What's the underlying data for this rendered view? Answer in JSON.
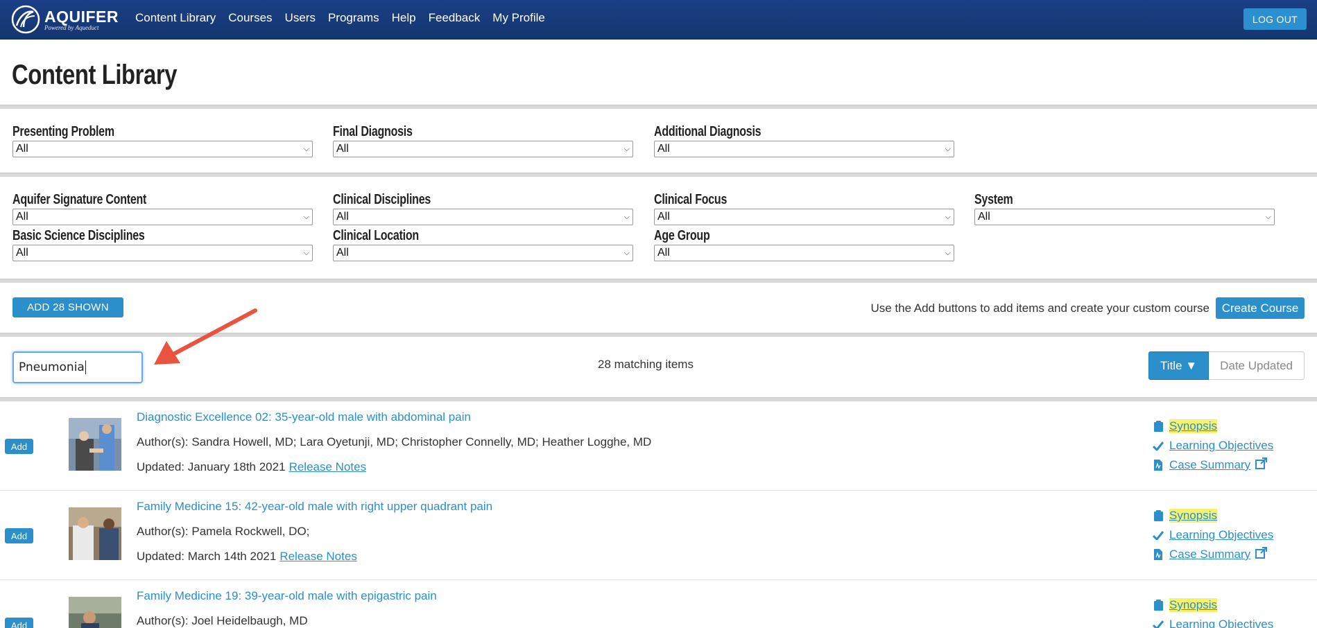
{
  "app": {
    "logo_text": "AQUIFER",
    "logo_sub": "Powered by Aqueduct"
  },
  "nav": {
    "links": [
      "Content Library",
      "Courses",
      "Users",
      "Programs",
      "Help",
      "Feedback",
      "My Profile"
    ],
    "logout": "LOG OUT"
  },
  "page": {
    "title": "Content Library"
  },
  "filters": {
    "presenting_problem": {
      "label": "Presenting Problem",
      "value": "All"
    },
    "final_diagnosis": {
      "label": "Final Diagnosis",
      "value": "All"
    },
    "additional_diagnosis": {
      "label": "Additional Diagnosis",
      "value": "All"
    },
    "signature_content": {
      "label": "Aquifer Signature Content",
      "value": "All"
    },
    "clinical_disciplines": {
      "label": "Clinical Disciplines",
      "value": "All"
    },
    "clinical_focus": {
      "label": "Clinical Focus",
      "value": "All"
    },
    "system": {
      "label": "System",
      "value": "All"
    },
    "basic_science": {
      "label": "Basic Science Disciplines",
      "value": "All"
    },
    "clinical_location": {
      "label": "Clinical Location",
      "value": "All"
    },
    "age_group": {
      "label": "Age Group",
      "value": "All"
    }
  },
  "actions": {
    "add_shown": "ADD 28 SHOWN",
    "hint": "Use the Add buttons to add items and create your custom course",
    "create_course": "Create Course"
  },
  "search": {
    "value": "Pneumonia"
  },
  "results": {
    "count_text": "28 matching items",
    "sort_title": "Title ▼",
    "sort_date": "Date Updated",
    "items": [
      {
        "add": "Add",
        "title": "Diagnostic Excellence 02: 35-year-old male with abdominal pain",
        "authors": "Author(s): Sandra Howell, MD; Lara Oyetunji, MD; Christopher Connelly, MD; Heather Logghe, MD",
        "updated": "Updated: January 18th 2021",
        "release_notes": "Release Notes",
        "synopsis": "Synopsis",
        "objectives": "Learning Objectives",
        "case_summary": "Case Summary"
      },
      {
        "add": "Add",
        "title": "Family Medicine 15: 42-year-old male with right upper quadrant pain",
        "authors": "Author(s): Pamela Rockwell, DO;",
        "updated": "Updated: March 14th 2021",
        "release_notes": "Release Notes",
        "synopsis": "Synopsis",
        "objectives": "Learning Objectives",
        "case_summary": "Case Summary"
      },
      {
        "add": "Add",
        "title": "Family Medicine 19: 39-year-old male with epigastric pain",
        "authors": "Author(s): Joel Heidelbaugh, MD",
        "synopsis": "Synopsis",
        "objectives": "Learning Objectives"
      }
    ]
  },
  "colors": {
    "navbar": "#1b3f86",
    "accent": "#2a8fcb",
    "highlight": "#f7f26e",
    "arrow": "#e8543f"
  }
}
